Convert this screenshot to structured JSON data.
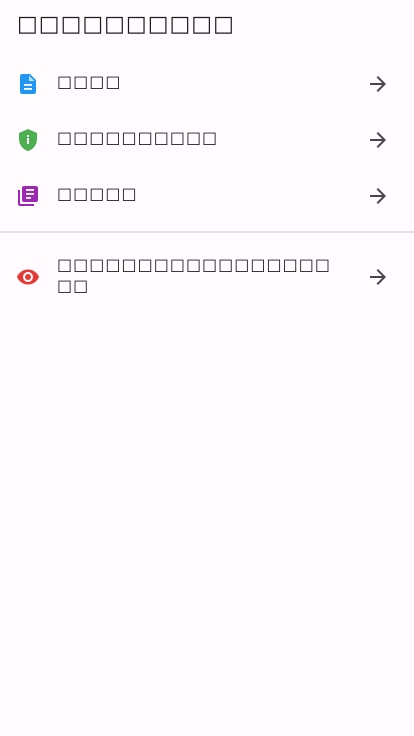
{
  "page": {
    "title": "□□□□□□□□□□"
  },
  "list": {
    "items": [
      {
        "label": "□□□□",
        "icon": "document-icon",
        "icon_color": "#2196f3"
      },
      {
        "label": "□□□□□□□□□□",
        "icon": "shield-info-icon",
        "icon_color": "#4caf50"
      },
      {
        "label": "□□□□□",
        "icon": "library-books-icon",
        "icon_color": "#9c27b0"
      },
      {
        "label": "□□□□□□□□□□□□□□□□□□□",
        "icon": "visibility-icon",
        "icon_color": "#e53935"
      }
    ],
    "trailing_icon": "arrow-forward-icon",
    "trailing_icon_color": "#49454f"
  },
  "colors": {
    "background": "#fffbfe",
    "text": "#1c1b1f",
    "divider": "#e3e1e6"
  }
}
